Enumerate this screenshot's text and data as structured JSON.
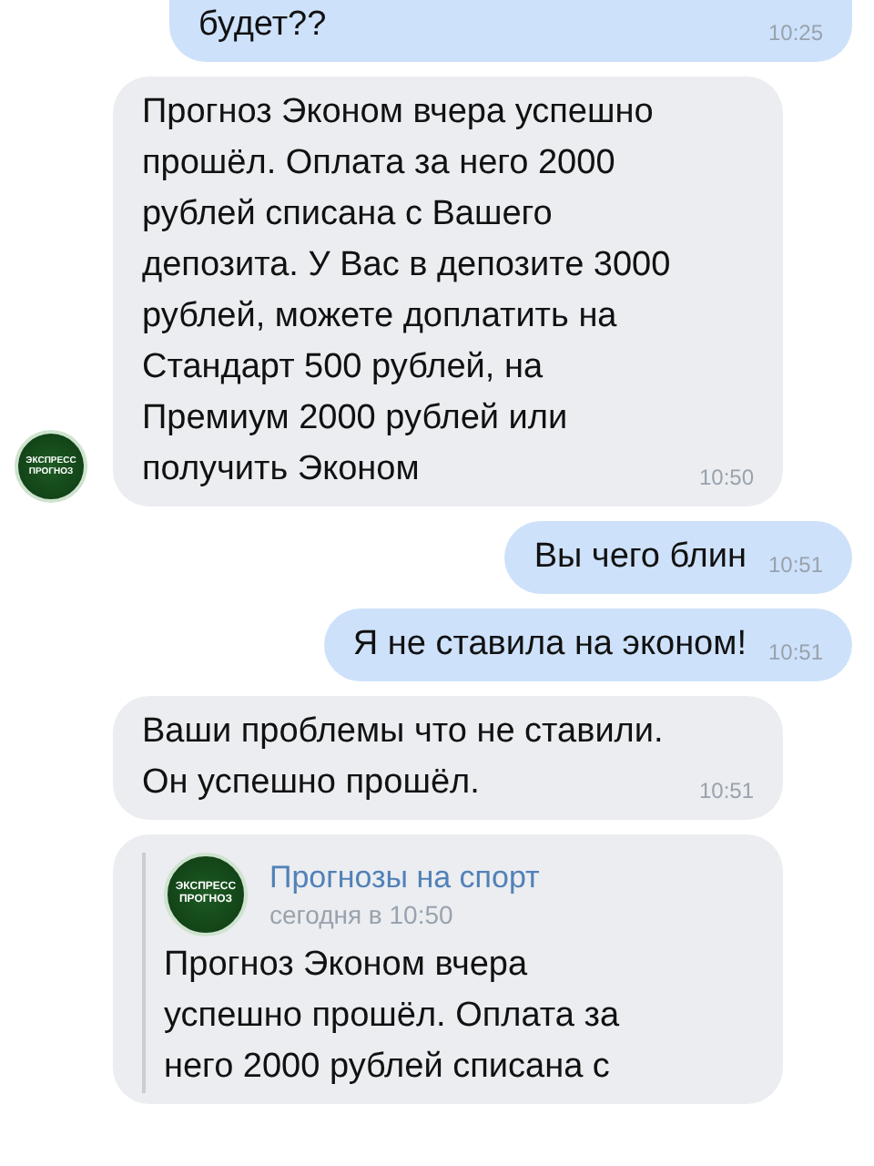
{
  "messages": [
    {
      "kind": "outgoing",
      "text": "будет??",
      "time": "10:25",
      "cut_top": true
    },
    {
      "kind": "incoming",
      "text": "Прогноз Эконом вчера успешно\nпрошёл. Оплата за него 2000\nрублей списана с Вашего\nдепозита. У Вас в депозите 3000\nрублей, можете доплатить на\nСтандарт 500 рублей, на\nПремиум 2000 рублей или\nполучить Эконом",
      "time": "10:50",
      "avatar": {
        "line1": "ЭКСПРЕСС",
        "line2": "ПРОГНОЗ"
      }
    },
    {
      "kind": "outgoing",
      "text": "Вы чего блин",
      "time": "10:51"
    },
    {
      "kind": "outgoing",
      "text": "Я не ставила на эконом!",
      "time": "10:51"
    },
    {
      "kind": "incoming",
      "text": "Ваши проблемы что не ставили.\nОн успешно прошёл.",
      "time": "10:51"
    },
    {
      "kind": "incoming",
      "forward": {
        "avatar": {
          "line1": "ЭКСПРЕСС",
          "line2": "ПРОГНОЗ"
        },
        "name": "Прогнозы на спорт",
        "date": "сегодня в 10:50",
        "text": "Прогноз Эконом вчера\nуспешно прошёл. Оплата за\nнего 2000 рублей списана с"
      }
    }
  ]
}
